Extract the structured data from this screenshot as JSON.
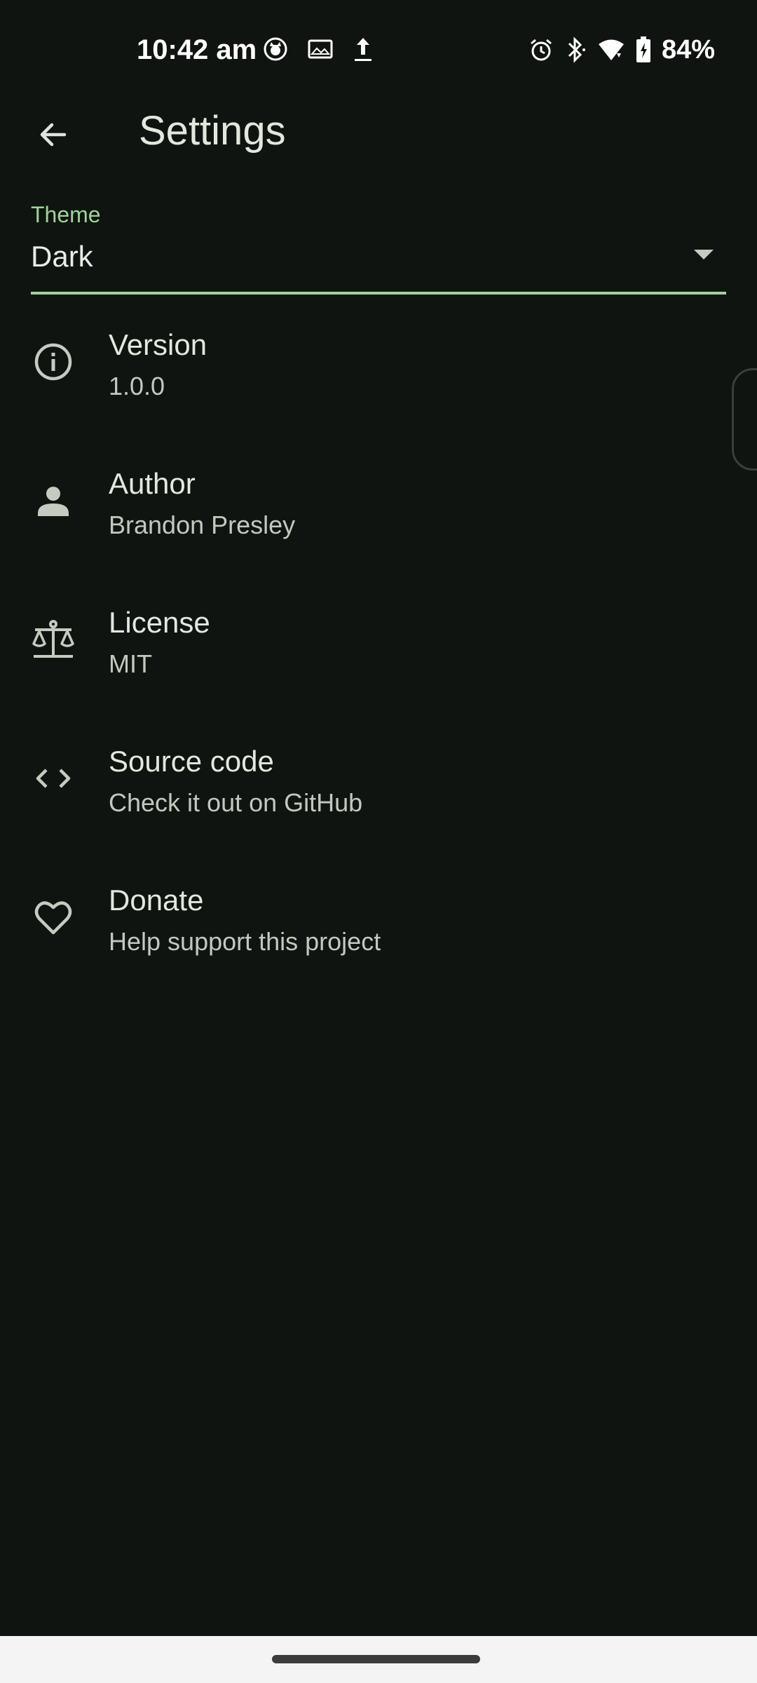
{
  "status_bar": {
    "time": "10:42 am",
    "battery_percent": "84%",
    "left_icons": [
      "cat-notification-icon",
      "image-icon",
      "upload-icon"
    ],
    "right_icons": [
      "alarm-icon",
      "bluetooth-icon",
      "wifi-icon",
      "battery-charging-icon"
    ]
  },
  "toolbar": {
    "title": "Settings",
    "back_icon": "arrow-back-icon"
  },
  "theme": {
    "label": "Theme",
    "value": "Dark"
  },
  "items": [
    {
      "icon": "info-icon",
      "title": "Version",
      "subtitle": "1.0.0"
    },
    {
      "icon": "person-icon",
      "title": "Author",
      "subtitle": "Brandon Presley"
    },
    {
      "icon": "scale-icon",
      "title": "License",
      "subtitle": "MIT"
    },
    {
      "icon": "code-icon",
      "title": "Source code",
      "subtitle": "Check it out on GitHub"
    },
    {
      "icon": "heart-icon",
      "title": "Donate",
      "subtitle": "Help support this project"
    }
  ],
  "colors": {
    "background": "#101410",
    "accent": "#9fd39a",
    "text_primary": "#e3e8df",
    "text_secondary": "#c3c8bf",
    "nav_bar": "#f4f4f4"
  }
}
